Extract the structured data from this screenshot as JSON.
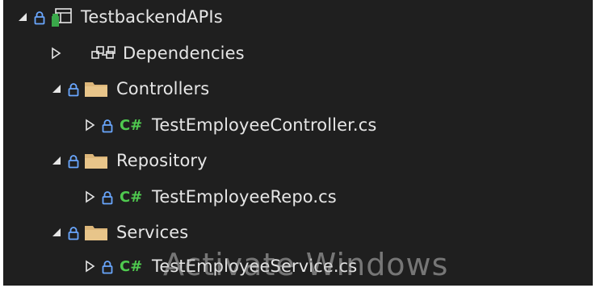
{
  "tree": {
    "project": {
      "label": "TestbackendAPIs",
      "expanded": true
    },
    "dependencies": {
      "label": "Dependencies",
      "expanded": false
    },
    "folders": [
      {
        "label": "Controllers",
        "expanded": true,
        "file": {
          "badge": "C#",
          "label": "TestEmployeeController.cs"
        }
      },
      {
        "label": "Repository",
        "expanded": true,
        "file": {
          "badge": "C#",
          "label": "TestEmployeeRepo.cs"
        }
      },
      {
        "label": "Services",
        "expanded": true,
        "file": {
          "badge": "C#",
          "label": "TestEmployeeService.cs"
        }
      }
    ]
  },
  "watermark": {
    "text": "Activate Windows"
  },
  "colors": {
    "background": "#1f1f1f",
    "text": "#e6e6e6",
    "lock": "#6aa7ff",
    "folder": "#dcb67a",
    "csharp": "#4fc94f"
  },
  "icons": {
    "expanded": "expanded-triangle-icon",
    "collapsed": "collapsed-triangle-icon",
    "lock": "lock-icon",
    "project": "project-icon",
    "dependencies": "dependencies-icon",
    "folder": "folder-icon"
  }
}
